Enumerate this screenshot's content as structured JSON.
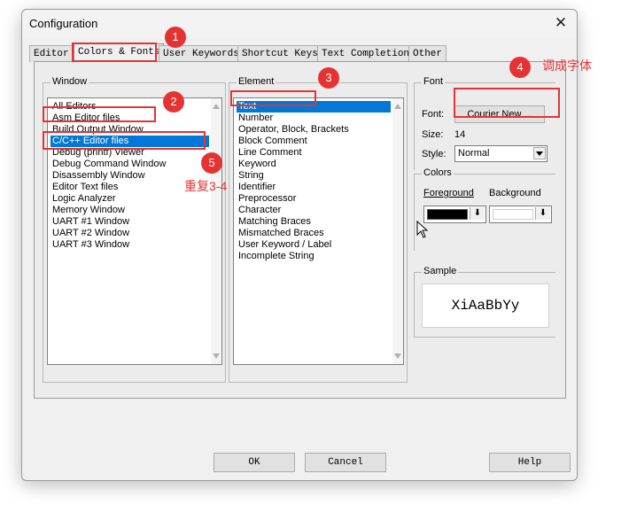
{
  "window": {
    "title": "Configuration",
    "close_glyph": "✕"
  },
  "tabs": [
    {
      "label": "Editor"
    },
    {
      "label": "Colors & Fonts"
    },
    {
      "label": "User Keywords"
    },
    {
      "label": "Shortcut Keys"
    },
    {
      "label": "Text Completion"
    },
    {
      "label": "Other"
    }
  ],
  "window_group": {
    "label": "Window",
    "items": [
      "All Editors",
      "Asm Editor files",
      "Build Output Window",
      "C/C++ Editor files",
      "Debug (printf) Viewer",
      "Debug Command Window",
      "Disassembly Window",
      "Editor Text files",
      "Logic Analyzer",
      "Memory Window",
      "UART #1 Window",
      "UART #2 Window",
      "UART #3 Window"
    ],
    "selected_index": 3
  },
  "element_group": {
    "label": "Element",
    "items": [
      "Text",
      "Number",
      "Operator, Block, Brackets",
      "Block Comment",
      "Line Comment",
      "Keyword",
      "String",
      "Identifier",
      "Preprocessor",
      "Character",
      "Matching Braces",
      "Mismatched Braces",
      "User Keyword / Label",
      "Incomplete String"
    ],
    "selected_index": 0
  },
  "font_group": {
    "label": "Font",
    "font_label": "Font:",
    "font_button": "Courier New ...",
    "size_label": "Size:",
    "size_value": "14",
    "style_label": "Style:",
    "style_value": "Normal"
  },
  "colors_group": {
    "label": "Colors",
    "foreground_label": "Foreground",
    "background_label": "Background",
    "foreground_color": "#000000",
    "background_color": "#ffffff"
  },
  "sample_group": {
    "label": "Sample",
    "text": "XiAaBbYy"
  },
  "buttons": {
    "ok": "OK",
    "cancel": "Cancel",
    "help": "Help"
  },
  "annotations": {
    "badges": [
      "1",
      "2",
      "3",
      "4",
      "5"
    ],
    "note_font": "调成字体",
    "note_repeat": "重复3-4",
    "color": "#e53333"
  },
  "colors": {
    "selection": "#0078d7",
    "annotation": "#e53333"
  }
}
